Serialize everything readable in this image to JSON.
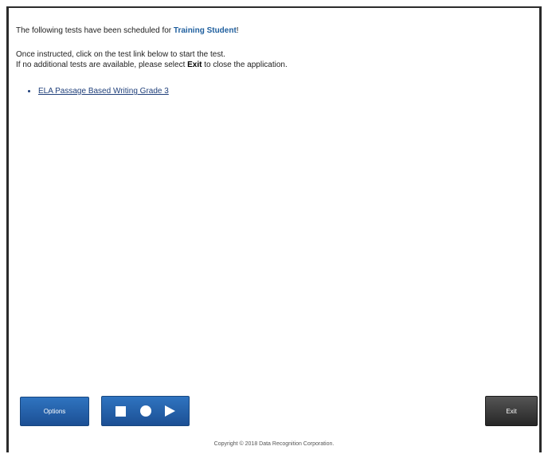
{
  "intro": {
    "prefix": "The following tests have been scheduled for ",
    "student_name": "Training Student",
    "suffix": "!"
  },
  "instructions": {
    "line1": "Once instructed, click on the test link below to start the test.",
    "line2_prefix": "If no additional tests are available, please select ",
    "line2_bold": "Exit",
    "line2_suffix": " to close the application."
  },
  "tests": [
    {
      "label": "ELA Passage Based Writing Grade 3"
    }
  ],
  "buttons": {
    "options_label": "Options",
    "exit_label": "Exit"
  },
  "media_controls": {
    "stop_icon": "stop-icon",
    "record_icon": "record-icon",
    "play_icon": "play-icon"
  },
  "colors": {
    "accent_blue": "#1f5f9e",
    "button_blue": "#2461a8",
    "exit_dark": "#333333"
  },
  "footer": {
    "copyright": "Copyright © 2018 Data Recognition Corporation."
  }
}
